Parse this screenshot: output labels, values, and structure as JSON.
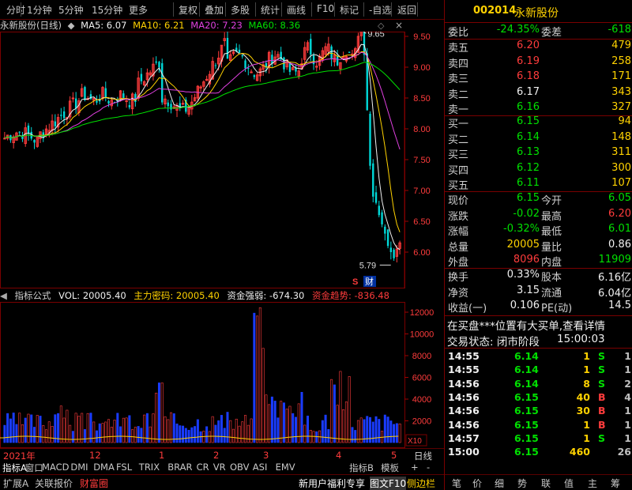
{
  "toolbar": {
    "items": [
      "分时",
      "1分钟",
      "5分钟",
      "15分钟",
      "更多",
      "复权",
      "叠加",
      "多股",
      "统计",
      "画线",
      "F10",
      "标记",
      "-自选",
      "返回"
    ]
  },
  "chart": {
    "stock_name": "永新股份(日线)",
    "ma5": "MA5: 6.07",
    "ma10": "MA10: 6.21",
    "ma20": "MA20: 7.23",
    "ma60": "MA60: 8.36",
    "high_label": "9.65",
    "low_label": "5.79",
    "s_label": "S",
    "cai_label": "财",
    "price_axis": [
      "9.50",
      "9.00",
      "8.50",
      "8.00",
      "7.50",
      "7.00",
      "6.50",
      "6.00"
    ],
    "vol_axis": [
      "12000",
      "10000",
      "8000",
      "6000",
      "4000",
      "2000"
    ],
    "x10": "X10",
    "dates": [
      "2021年",
      "12",
      "1",
      "2",
      "3",
      "4",
      "5"
    ],
    "period": "日线"
  },
  "indicator": {
    "title": "指标公式",
    "vol": "VOL: 20005.40",
    "zhuli": "主力密码: 20005.40",
    "qiangruo": "资金强弱: -674.30",
    "qushi": "资金趋势: -836.48"
  },
  "index_bar": {
    "left": [
      "指标A",
      "窗口",
      "MACD",
      "DMI",
      "DMA",
      "FSL",
      "TRIX",
      "BRAR",
      "CR",
      "VR",
      "OBV",
      "ASI",
      "EMV"
    ],
    "right": [
      "指标B",
      "模板",
      "+",
      "-"
    ]
  },
  "status": {
    "items": [
      "扩展A",
      "关联报价",
      "财富圈"
    ],
    "promo": "新用户福利专享",
    "tuwen": "图文F10",
    "cebian": "侧边栏",
    "right_tabs": [
      "笔",
      "价",
      "细",
      "势",
      "联",
      "值",
      "主",
      "筹"
    ]
  },
  "quote": {
    "code": "002014",
    "name": "永新股份",
    "weibi_label": "委比",
    "weibi": "-24.35%",
    "weicha_label": "委差",
    "weicha": "-618",
    "asks": [
      {
        "label": "卖五",
        "price": "6.20",
        "vol": "479"
      },
      {
        "label": "卖四",
        "price": "6.19",
        "vol": "258"
      },
      {
        "label": "卖三",
        "price": "6.18",
        "vol": "171"
      },
      {
        "label": "卖二",
        "price": "6.17",
        "vol": "343"
      },
      {
        "label": "卖一",
        "price": "6.16",
        "vol": "327"
      }
    ],
    "bids": [
      {
        "label": "买一",
        "price": "6.15",
        "vol": "94"
      },
      {
        "label": "买二",
        "price": "6.14",
        "vol": "148"
      },
      {
        "label": "买三",
        "price": "6.13",
        "vol": "311"
      },
      {
        "label": "买四",
        "price": "6.12",
        "vol": "300"
      },
      {
        "label": "买五",
        "price": "6.11",
        "vol": "107"
      }
    ],
    "stats": [
      {
        "l": "现价",
        "v1": "6.15",
        "l2": "今开",
        "v2": "6.05"
      },
      {
        "l": "涨跌",
        "v1": "-0.02",
        "l2": "最高",
        "v2": "6.20"
      },
      {
        "l": "涨幅",
        "v1": "-0.32%",
        "l2": "最低",
        "v2": "6.01"
      },
      {
        "l": "总量",
        "v1": "20005",
        "l2": "量比",
        "v2": "0.86"
      },
      {
        "l": "外盘",
        "v1": "8096",
        "l2": "内盘",
        "v2": "11909"
      }
    ],
    "fund": [
      {
        "l": "换手",
        "v1": "0.33%",
        "l2": "股本",
        "v2": "6.16亿"
      },
      {
        "l": "净资",
        "v1": "3.15",
        "l2": "流通",
        "v2": "6.04亿"
      },
      {
        "l": "收益(一)",
        "v1": "0.106",
        "l2": "PE(动)",
        "v2": "14.5"
      }
    ],
    "notice": "在买盘***位置有大买单,查看详情",
    "trade_state": "交易状态: 闭市阶段",
    "trade_time": "15:00:03",
    "ticks": [
      {
        "t": "14:55",
        "p": "6.14",
        "v": "1",
        "d": "S",
        "n": "1"
      },
      {
        "t": "14:55",
        "p": "6.14",
        "v": "1",
        "d": "S",
        "n": "1"
      },
      {
        "t": "14:56",
        "p": "6.14",
        "v": "8",
        "d": "S",
        "n": "2"
      },
      {
        "t": "14:56",
        "p": "6.15",
        "v": "40",
        "d": "B",
        "n": "4"
      },
      {
        "t": "14:56",
        "p": "6.15",
        "v": "30",
        "d": "B",
        "n": "1"
      },
      {
        "t": "14:56",
        "p": "6.15",
        "v": "1",
        "d": "B",
        "n": "1"
      },
      {
        "t": "14:57",
        "p": "6.15",
        "v": "1",
        "d": "S",
        "n": "1"
      },
      {
        "t": "15:00",
        "p": "6.15",
        "v": "460",
        "d": "",
        "n": "26"
      }
    ]
  }
}
